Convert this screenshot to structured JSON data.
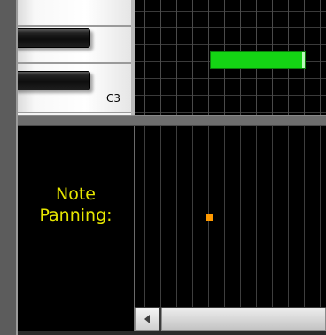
{
  "piano": {
    "key_label": "C3"
  },
  "velocity_panel": {
    "label_line1": "Note",
    "label_line2": "Panning:"
  },
  "colors": {
    "note_block": "#14d414",
    "pan_marker": "#ff9900",
    "label_text": "#e6e600"
  },
  "icons": {
    "scroll_left": "left-triangle-arrow"
  }
}
